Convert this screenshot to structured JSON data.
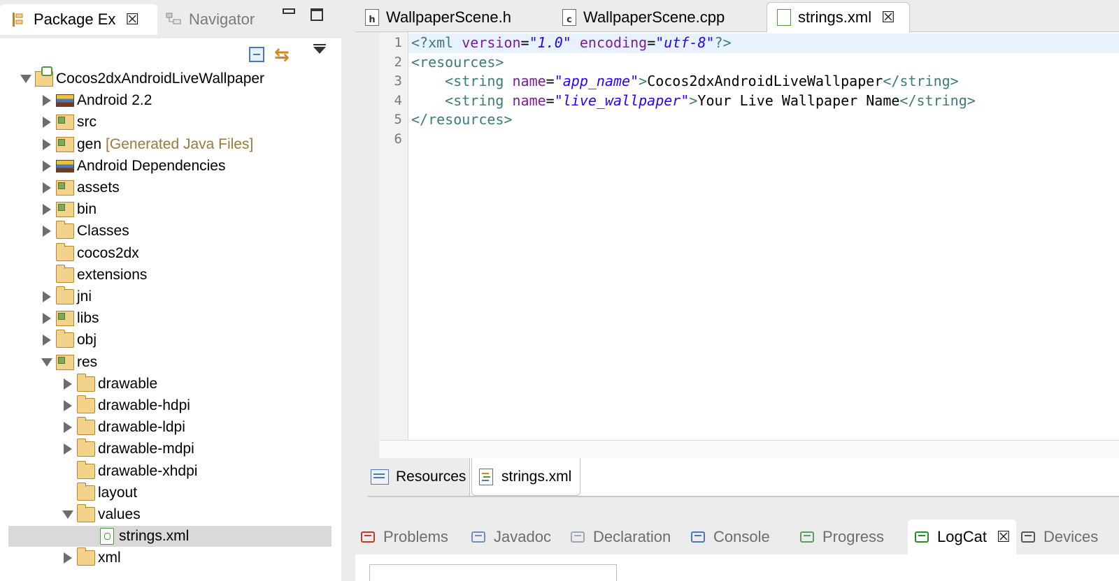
{
  "left_panel": {
    "tabs": [
      {
        "label": "Package Ex",
        "active": true
      },
      {
        "label": "Navigator",
        "active": false
      }
    ],
    "tree": [
      {
        "label": "Cocos2dxAndroidLiveWallpaper",
        "depth": 0,
        "arrow": "open",
        "icon": "project-icon"
      },
      {
        "label": "Android 2.2",
        "depth": 1,
        "arrow": "closed",
        "icon": "library-icon"
      },
      {
        "label": "src",
        "depth": 1,
        "arrow": "closed",
        "icon": "source-folder-icon"
      },
      {
        "label": "gen",
        "suffix": "[Generated Java Files]",
        "depth": 1,
        "arrow": "closed",
        "icon": "source-folder-icon"
      },
      {
        "label": "Android Dependencies",
        "depth": 1,
        "arrow": "closed",
        "icon": "library-icon"
      },
      {
        "label": "assets",
        "depth": 1,
        "arrow": "closed",
        "icon": "source-folder-icon"
      },
      {
        "label": "bin",
        "depth": 1,
        "arrow": "closed",
        "icon": "source-folder-icon"
      },
      {
        "label": "Classes",
        "depth": 1,
        "arrow": "closed",
        "icon": "linked-folder-icon"
      },
      {
        "label": "cocos2dx",
        "depth": 1,
        "arrow": "none",
        "icon": "warning-folder-icon"
      },
      {
        "label": "extensions",
        "depth": 1,
        "arrow": "none",
        "icon": "warning-folder-icon"
      },
      {
        "label": "jni",
        "depth": 1,
        "arrow": "closed",
        "icon": "folder-icon"
      },
      {
        "label": "libs",
        "depth": 1,
        "arrow": "closed",
        "icon": "source-folder-icon"
      },
      {
        "label": "obj",
        "depth": 1,
        "arrow": "closed",
        "icon": "folder-icon"
      },
      {
        "label": "res",
        "depth": 1,
        "arrow": "open",
        "icon": "source-folder-icon"
      },
      {
        "label": "drawable",
        "depth": 2,
        "arrow": "closed",
        "icon": "folder-icon"
      },
      {
        "label": "drawable-hdpi",
        "depth": 2,
        "arrow": "closed",
        "icon": "folder-icon"
      },
      {
        "label": "drawable-ldpi",
        "depth": 2,
        "arrow": "closed",
        "icon": "folder-icon"
      },
      {
        "label": "drawable-mdpi",
        "depth": 2,
        "arrow": "closed",
        "icon": "folder-icon"
      },
      {
        "label": "drawable-xhdpi",
        "depth": 2,
        "arrow": "none",
        "icon": "folder-icon"
      },
      {
        "label": "layout",
        "depth": 2,
        "arrow": "none",
        "icon": "folder-icon"
      },
      {
        "label": "values",
        "depth": 2,
        "arrow": "open",
        "icon": "folder-icon"
      },
      {
        "label": "strings.xml",
        "depth": 3,
        "arrow": "none",
        "icon": "xml-file-icon",
        "selected": true
      },
      {
        "label": "xml",
        "depth": 2,
        "arrow": "closed",
        "icon": "folder-icon"
      }
    ]
  },
  "editor": {
    "tabs": [
      {
        "label": "WallpaperScene.h",
        "icon_letter": "h",
        "active": false
      },
      {
        "label": "WallpaperScene.cpp",
        "icon_letter": "c",
        "active": false
      },
      {
        "label": "strings.xml",
        "icon_letter": "",
        "active": true
      }
    ],
    "line_numbers": [
      "1",
      "2",
      "3",
      "4",
      "5",
      "6"
    ],
    "lines": [
      [
        {
          "t": "<?xml ",
          "c": "tag"
        },
        {
          "t": "version",
          "c": "attr"
        },
        {
          "t": "=",
          "c": "txt"
        },
        {
          "t": "\"1.0\"",
          "c": "val"
        },
        {
          "t": " ",
          "c": "txt"
        },
        {
          "t": "encoding",
          "c": "attr"
        },
        {
          "t": "=",
          "c": "txt"
        },
        {
          "t": "\"utf-8\"",
          "c": "val"
        },
        {
          "t": "?>",
          "c": "tag"
        }
      ],
      [
        {
          "t": "<resources>",
          "c": "tag"
        }
      ],
      [
        {
          "t": "    ",
          "c": "txt"
        },
        {
          "t": "<string ",
          "c": "tag"
        },
        {
          "t": "name",
          "c": "attr"
        },
        {
          "t": "=",
          "c": "txt"
        },
        {
          "t": "\"app_name\"",
          "c": "val"
        },
        {
          "t": ">",
          "c": "tag"
        },
        {
          "t": "Cocos2dxAndroidLiveWallpaper",
          "c": "txt"
        },
        {
          "t": "</string>",
          "c": "tag"
        }
      ],
      [
        {
          "t": "    ",
          "c": "txt"
        },
        {
          "t": "<string ",
          "c": "tag"
        },
        {
          "t": "name",
          "c": "attr"
        },
        {
          "t": "=",
          "c": "txt"
        },
        {
          "t": "\"live_wallpaper\"",
          "c": "val"
        },
        {
          "t": ">",
          "c": "tag"
        },
        {
          "t": "Your Live Wallpaper Name",
          "c": "txt"
        },
        {
          "t": "</string>",
          "c": "tag"
        }
      ],
      [
        {
          "t": "</resources>",
          "c": "tag"
        }
      ],
      []
    ],
    "bottom_tabs": [
      {
        "label": "Resources",
        "active": false
      },
      {
        "label": "strings.xml",
        "active": true
      }
    ]
  },
  "console_panel": {
    "tabs": [
      {
        "label": "Problems",
        "icon": "problems-icon",
        "active": false
      },
      {
        "label": "Javadoc",
        "icon": "javadoc-icon",
        "active": false
      },
      {
        "label": "Declaration",
        "icon": "declaration-icon",
        "active": false
      },
      {
        "label": "Console",
        "icon": "console-icon",
        "active": false
      },
      {
        "label": "Progress",
        "icon": "progress-icon",
        "active": false
      },
      {
        "label": "LogCat",
        "icon": "logcat-icon",
        "active": true
      },
      {
        "label": "Devices",
        "icon": "devices-icon",
        "active": false
      }
    ]
  },
  "colors": {
    "xml_tag": "#3c7b7b",
    "xml_attribute": "#7d1c9f",
    "xml_value": "#2a00ff",
    "selection": "#d9d9d9",
    "current_line": "#e8f2fe"
  }
}
